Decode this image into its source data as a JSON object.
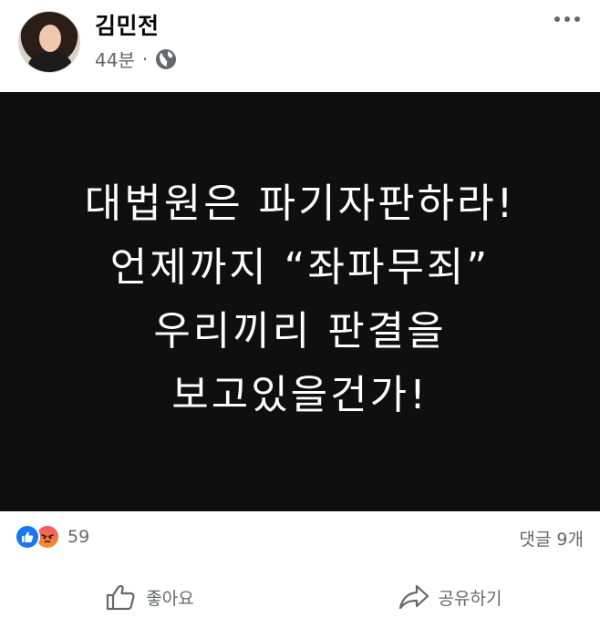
{
  "post": {
    "author": "김민전",
    "time": "44분",
    "separator": "·",
    "privacy_icon": "globe-icon",
    "more_icon": "more-icon"
  },
  "image_text": {
    "lines": [
      "대법원은 파기자판하라!",
      "언제까지 “좌파무죄”",
      "우리끼리 판결을",
      "보고있을건가!"
    ]
  },
  "reactions": {
    "icons": [
      "like-reaction-icon",
      "angry-reaction-icon"
    ],
    "count": "59",
    "comments": "댓글 9개"
  },
  "actions": {
    "like_label": "좋아요",
    "share_label": "공유하기"
  },
  "colors": {
    "facebook_blue": "#1877f2",
    "secondary_text": "#65676b",
    "image_background": "#0f0f0f"
  }
}
